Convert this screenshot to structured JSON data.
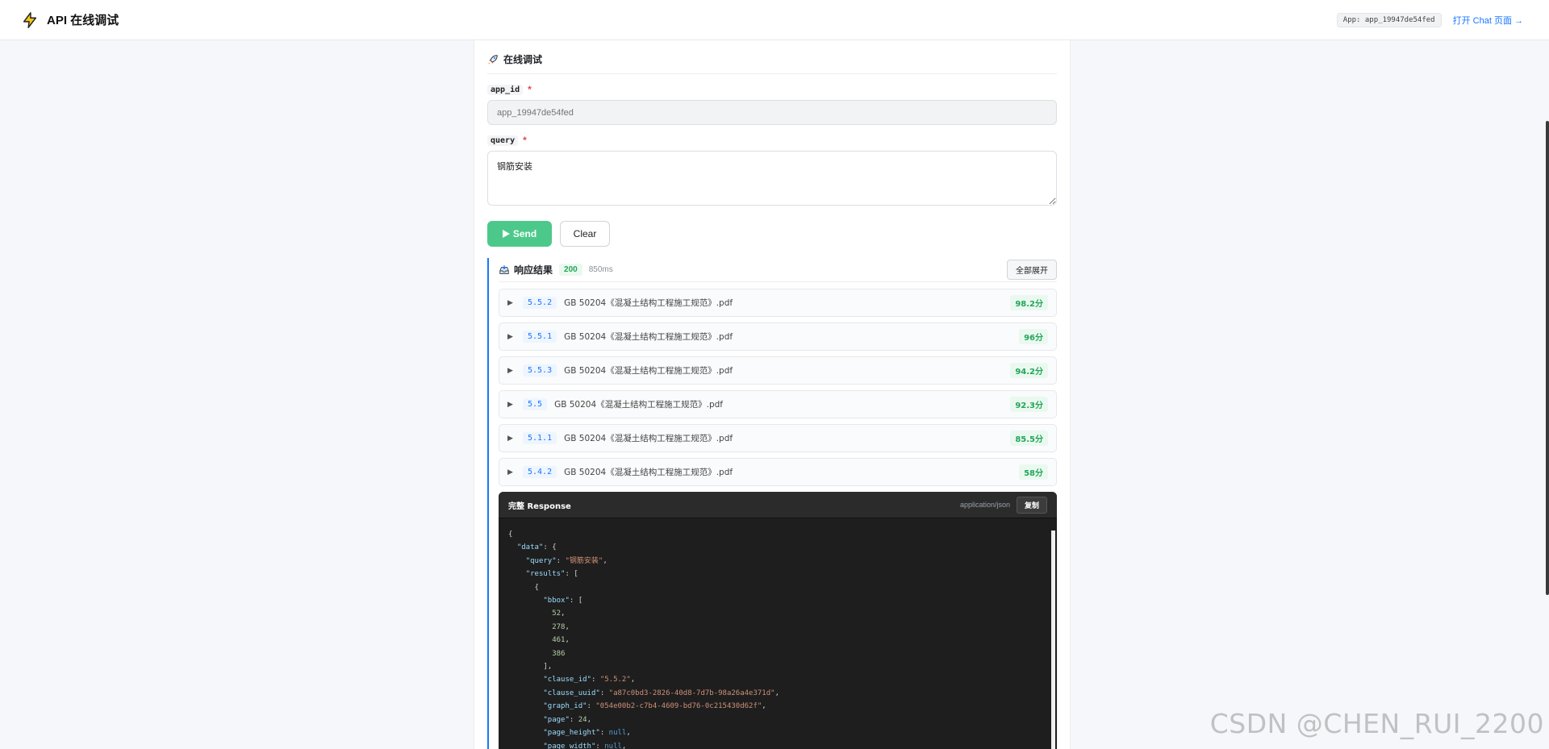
{
  "header": {
    "title": "API 在线调试",
    "app_badge": "App: app_19947de54fed",
    "open_chat_link": "打开 Chat 页面 →"
  },
  "form": {
    "section_title": "在线调试",
    "app_id": {
      "label": "app_id",
      "required_mark": "*",
      "placeholder": "app_19947de54fed"
    },
    "query": {
      "label": "query",
      "required_mark": "*",
      "value": "钢筋安装"
    },
    "send_label": "Send",
    "clear_label": "Clear"
  },
  "result": {
    "title": "响应结果",
    "status_code": "200",
    "elapsed": "850ms",
    "expand_all_label": "全部展开",
    "items": [
      {
        "clause": "5.5.2",
        "doc": "GB 50204《混凝土结构工程施工规范》.pdf",
        "score": "98.2分"
      },
      {
        "clause": "5.5.1",
        "doc": "GB 50204《混凝土结构工程施工规范》.pdf",
        "score": "96分"
      },
      {
        "clause": "5.5.3",
        "doc": "GB 50204《混凝土结构工程施工规范》.pdf",
        "score": "94.2分"
      },
      {
        "clause": "5.5",
        "doc": "GB 50204《混凝土结构工程施工规范》.pdf",
        "score": "92.3分"
      },
      {
        "clause": "5.1.1",
        "doc": "GB 50204《混凝土结构工程施工规范》.pdf",
        "score": "85.5分"
      },
      {
        "clause": "5.4.2",
        "doc": "GB 50204《混凝土结构工程施工规范》.pdf",
        "score": "58分"
      }
    ]
  },
  "response": {
    "title": "完整 Response",
    "content_type": "application/json",
    "copy_label": "复制",
    "lines": [
      "{",
      "  \"data\": {",
      "    \"query\": \"钢筋安装\",",
      "    \"results\": [",
      "      {",
      "        \"bbox\": [",
      "          52,",
      "          278,",
      "          461,",
      "          386",
      "        ],",
      "        \"clause_id\": \"5.5.2\",",
      "        \"clause_uuid\": \"a87c0bd3-2826-40d8-7d7b-98a26a4e371d\",",
      "        \"graph_id\": \"054e00b2-c7b4-4609-bd76-0c215430d62f\",",
      "        \"page\": 24,",
      "        \"page_height\": null,",
      "        \"page_width\": null,"
    ]
  },
  "watermark": "CSDN @CHEN_RUI_2200",
  "colors": {
    "accent": "#1677ff",
    "send": "#4cc98a",
    "success": "#23a55a"
  }
}
